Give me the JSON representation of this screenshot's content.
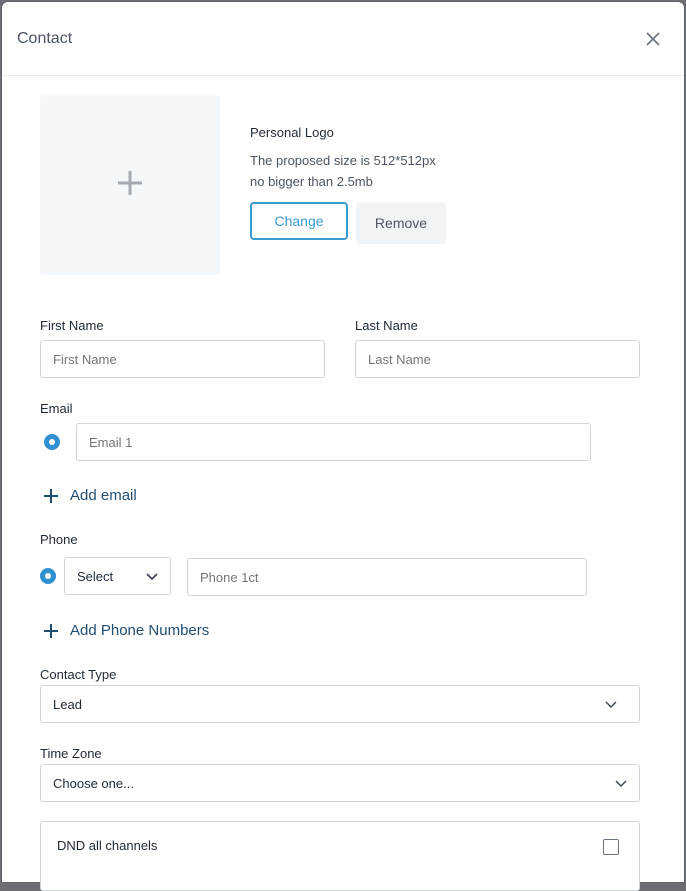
{
  "modal": {
    "title": "Contact"
  },
  "logo": {
    "title": "Personal Logo",
    "hint_line1": "The proposed size is 512*512px",
    "hint_line2": "no bigger than 2.5mb",
    "change_label": "Change",
    "remove_label": "Remove"
  },
  "first_name": {
    "label": "First Name",
    "placeholder": "First Name",
    "value": ""
  },
  "last_name": {
    "label": "Last Name",
    "placeholder": "Last Name",
    "value": ""
  },
  "email": {
    "label": "Email",
    "placeholder": "Email 1",
    "value": "",
    "add_label": "Add email"
  },
  "phone": {
    "label": "Phone",
    "country_select": "Select",
    "placeholder": "Phone 1ct",
    "value": "",
    "add_label": "Add Phone Numbers"
  },
  "contact_type": {
    "label": "Contact Type",
    "selected": "Lead"
  },
  "time_zone": {
    "label": "Time Zone",
    "selected": "Choose one..."
  },
  "dnd": {
    "label": "DND all channels",
    "checked": false
  },
  "colors": {
    "accent": "#3a9bd3",
    "link": "#1f4e73",
    "radio": "#2f8fd0"
  }
}
